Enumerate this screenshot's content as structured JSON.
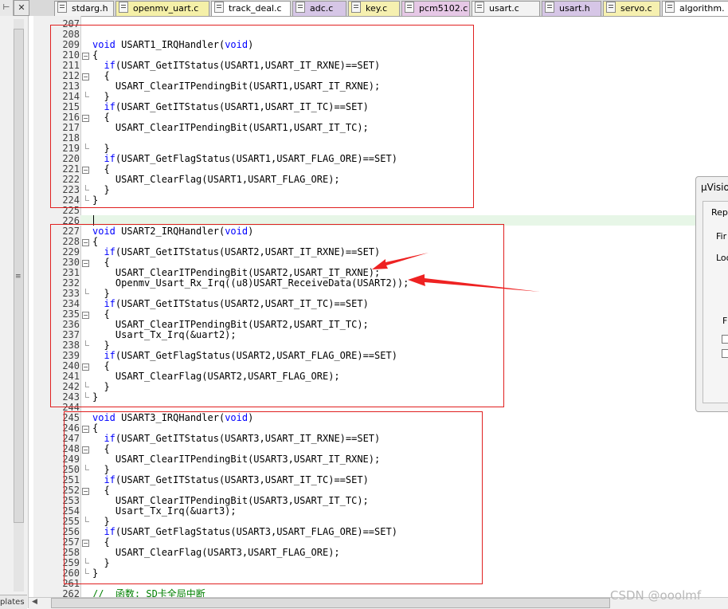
{
  "tabs": [
    {
      "label": "stdarg.h",
      "color": "#f3f3f3"
    },
    {
      "label": "openmv_uart.c",
      "color": "#f5f0a8"
    },
    {
      "label": "track_deal.c",
      "color": "#ffffff"
    },
    {
      "label": "adc.c",
      "color": "#d6c6e6"
    },
    {
      "label": "key.c",
      "color": "#f6f0b0"
    },
    {
      "label": "pcm5102.c",
      "color": "#e6c8e6"
    },
    {
      "label": "usart.c",
      "color": "#f3f3f3"
    },
    {
      "label": "usart.h",
      "color": "#d6c6e6"
    },
    {
      "label": "servo.c",
      "color": "#f6f0b0"
    },
    {
      "label": "algorithm.",
      "color": "#ffffff"
    }
  ],
  "left_panel": {
    "templates_label": "plates"
  },
  "editor": {
    "lines": [
      {
        "n": "207",
        "t": ""
      },
      {
        "n": "208",
        "t": ""
      },
      {
        "n": "209",
        "t": "void USART1_IRQHandler(void)"
      },
      {
        "n": "210",
        "t": "{"
      },
      {
        "n": "211",
        "t": "  if(USART_GetITStatus(USART1,USART_IT_RXNE)==SET)"
      },
      {
        "n": "212",
        "t": "  {"
      },
      {
        "n": "213",
        "t": "    USART_ClearITPendingBit(USART1,USART_IT_RXNE);"
      },
      {
        "n": "214",
        "t": "  }"
      },
      {
        "n": "215",
        "t": "  if(USART_GetITStatus(USART1,USART_IT_TC)==SET)"
      },
      {
        "n": "216",
        "t": "  {"
      },
      {
        "n": "217",
        "t": "    USART_ClearITPendingBit(USART1,USART_IT_TC);"
      },
      {
        "n": "218",
        "t": ""
      },
      {
        "n": "219",
        "t": "  }"
      },
      {
        "n": "220",
        "t": "  if(USART_GetFlagStatus(USART1,USART_FLAG_ORE)==SET)"
      },
      {
        "n": "221",
        "t": "  {"
      },
      {
        "n": "222",
        "t": "    USART_ClearFlag(USART1,USART_FLAG_ORE);"
      },
      {
        "n": "223",
        "t": "  }"
      },
      {
        "n": "224",
        "t": "}"
      },
      {
        "n": "225",
        "t": ""
      },
      {
        "n": "226",
        "t": ""
      },
      {
        "n": "227",
        "t": "void USART2_IRQHandler(void)"
      },
      {
        "n": "228",
        "t": "{"
      },
      {
        "n": "229",
        "t": "  if(USART_GetITStatus(USART2,USART_IT_RXNE)==SET)"
      },
      {
        "n": "230",
        "t": "  {"
      },
      {
        "n": "231",
        "t": "    USART_ClearITPendingBit(USART2,USART_IT_RXNE);"
      },
      {
        "n": "232",
        "t": "    Openmv_Usart_Rx_Irq((u8)USART_ReceiveData(USART2));"
      },
      {
        "n": "233",
        "t": "  }"
      },
      {
        "n": "234",
        "t": "  if(USART_GetITStatus(USART2,USART_IT_TC)==SET)"
      },
      {
        "n": "235",
        "t": "  {"
      },
      {
        "n": "236",
        "t": "    USART_ClearITPendingBit(USART2,USART_IT_TC);"
      },
      {
        "n": "237",
        "t": "    Usart_Tx_Irq(&uart2);"
      },
      {
        "n": "238",
        "t": "  }"
      },
      {
        "n": "239",
        "t": "  if(USART_GetFlagStatus(USART2,USART_FLAG_ORE)==SET)"
      },
      {
        "n": "240",
        "t": "  {"
      },
      {
        "n": "241",
        "t": "    USART_ClearFlag(USART2,USART_FLAG_ORE);"
      },
      {
        "n": "242",
        "t": "  }"
      },
      {
        "n": "243",
        "t": "}"
      },
      {
        "n": "244",
        "t": ""
      },
      {
        "n": "245",
        "t": "void USART3_IRQHandler(void)"
      },
      {
        "n": "246",
        "t": "{"
      },
      {
        "n": "247",
        "t": "  if(USART_GetITStatus(USART3,USART_IT_RXNE)==SET)"
      },
      {
        "n": "248",
        "t": "  {"
      },
      {
        "n": "249",
        "t": "    USART_ClearITPendingBit(USART3,USART_IT_RXNE);"
      },
      {
        "n": "250",
        "t": "  }"
      },
      {
        "n": "251",
        "t": "  if(USART_GetITStatus(USART3,USART_IT_TC)==SET)"
      },
      {
        "n": "252",
        "t": "  {"
      },
      {
        "n": "253",
        "t": "    USART_ClearITPendingBit(USART3,USART_IT_TC);"
      },
      {
        "n": "254",
        "t": "    Usart_Tx_Irq(&uart3);"
      },
      {
        "n": "255",
        "t": "  }"
      },
      {
        "n": "256",
        "t": "  if(USART_GetFlagStatus(USART3,USART_FLAG_ORE)==SET)"
      },
      {
        "n": "257",
        "t": "  {"
      },
      {
        "n": "258",
        "t": "    USART_ClearFlag(USART3,USART_FLAG_ORE);"
      },
      {
        "n": "259",
        "t": "  }"
      },
      {
        "n": "260",
        "t": "}"
      },
      {
        "n": "261",
        "t": ""
      },
      {
        "n": "262",
        "t": "//  函数: SD卡全局中断"
      }
    ]
  },
  "dialog": {
    "title": "µVisio",
    "labels": [
      "Repl",
      "Fir",
      "Loo",
      "F"
    ]
  },
  "watermark": "CSDN @ooolmf",
  "colors": {
    "keyword": "#0000ff",
    "comment": "#008000",
    "annotation": "#e02020",
    "current_line": "#e7f6e7"
  }
}
